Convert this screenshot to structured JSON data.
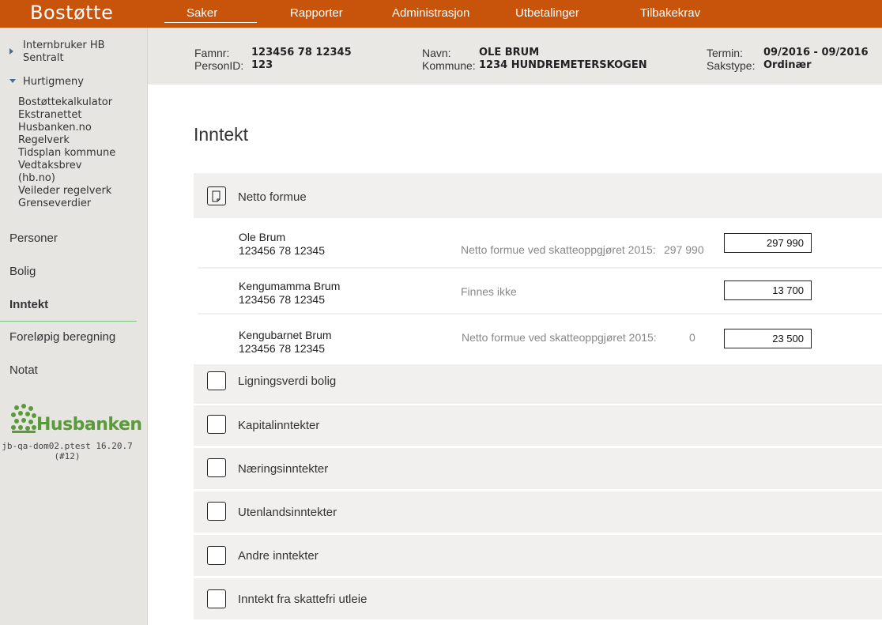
{
  "app": {
    "title": "Bostøtte"
  },
  "topnav": {
    "items": [
      {
        "label": "Saker",
        "active": true
      },
      {
        "label": "Rapporter",
        "active": false
      },
      {
        "label": "Administrasjon",
        "active": false
      },
      {
        "label": "Utbetalinger",
        "active": false
      },
      {
        "label": "Tilbakekrav",
        "active": false
      }
    ]
  },
  "sidebar": {
    "internbruker": {
      "line1": "Internbruker HB",
      "line2": "Sentralt"
    },
    "hurtigmeny": {
      "label": "Hurtigmeny",
      "links": [
        "Bostøttekalkulator",
        "Ekstranettet",
        "Husbanken.no",
        "Regelverk",
        "Tidsplan kommune",
        "Vedtaksbrev",
        "(hb.no)",
        "Veileder regelverk",
        "Grenseverdier"
      ]
    },
    "menu": [
      {
        "label": "Personer",
        "active": false
      },
      {
        "label": "Bolig",
        "active": false
      },
      {
        "label": "Inntekt",
        "active": true
      },
      {
        "label": "Foreløpig beregning",
        "active": false
      },
      {
        "label": "Notat",
        "active": false
      }
    ],
    "logo_text": "Husbanken",
    "version": {
      "line1": "jb-qa-dom02.ptest 16.20.7",
      "line2": "(#12)"
    },
    "colors": {
      "logo_green": "#5a9a3a",
      "active_divider": "#7cc47c"
    }
  },
  "header": {
    "famnr_label": "Famnr:",
    "famnr_value": "123456 78 12345",
    "personid_label": "PersonID:",
    "personid_value": "123",
    "navn_label": "Navn:",
    "navn_value": "OLE BRUM",
    "kommune_label": "Kommune:",
    "kommune_value": "1234 HUNDREMETERSKOGEN",
    "termin_label": "Termin:",
    "termin_value": "09/2016 - 09/2016",
    "sakstype_label": "Sakstype:",
    "sakstype_value": "Ordinær"
  },
  "main": {
    "title": "Inntekt",
    "netto_formue": {
      "label": "Netto formue",
      "expanded": true,
      "rows": [
        {
          "name": "Ole Brum",
          "nr": "123456 78 12345",
          "note": "Netto formue ved skatteoppgjøret 2015:",
          "note_value": "297 990",
          "amount": "297 990"
        },
        {
          "name": "Kengumamma Brum",
          "nr": "123456 78 12345",
          "note": "Finnes ikke",
          "note_value": "",
          "amount": "13 700"
        },
        {
          "name": "Kengubarnet Brum",
          "nr": "123456 78 12345",
          "note": "Netto formue ved skatteoppgjøret 2015:",
          "note_value": "0",
          "amount": "23 500"
        }
      ]
    },
    "sections": [
      {
        "label": "Ligningsverdi bolig"
      },
      {
        "label": "Kapitalinntekter"
      },
      {
        "label": "Næringsinntekter"
      },
      {
        "label": "Utenlandsinntekter"
      },
      {
        "label": "Andre inntekter"
      },
      {
        "label": "Inntekt fra skattefri utleie"
      }
    ]
  },
  "colors": {
    "topbar": "#c8530a",
    "sidebar_bg": "#e6e5e2",
    "header_bg": "#e9e8e5",
    "section_bg": "#f1f0ee"
  }
}
